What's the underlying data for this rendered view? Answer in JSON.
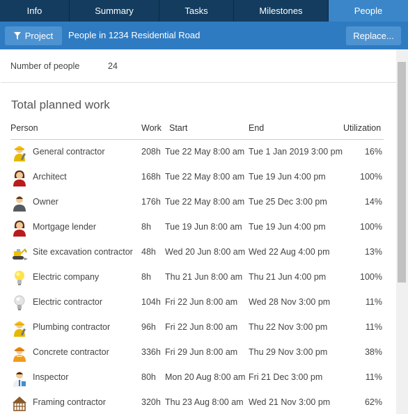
{
  "tabs": [
    {
      "label": "Info",
      "active": false
    },
    {
      "label": "Summary",
      "active": false
    },
    {
      "label": "Tasks",
      "active": false
    },
    {
      "label": "Milestones",
      "active": false
    },
    {
      "label": "People",
      "active": true
    }
  ],
  "toolbar": {
    "project_label": "Project",
    "title": "People in 1234 Residential Road",
    "replace_label": "Replace..."
  },
  "summary": {
    "count_label": "Number of people",
    "count_value": "24"
  },
  "section_title": "Total planned work",
  "table": {
    "headers": {
      "person": "Person",
      "work": "Work",
      "start": "Start",
      "end": "End",
      "utilization": "Utilization"
    },
    "rows": [
      {
        "name": "General contractor",
        "work": "208h",
        "start": "Tue 22 May 8:00 am",
        "end": "Tue 1 Jan 2019 3:00 pm",
        "util": "16%",
        "icon": "construction-worker-icon"
      },
      {
        "name": "Architect",
        "work": "168h",
        "start": "Tue 22 May 8:00 am",
        "end": "Tue 19 Jun 4:00 pm",
        "util": "100%",
        "icon": "person-female-icon"
      },
      {
        "name": "Owner",
        "work": "176h",
        "start": "Tue 22 May 8:00 am",
        "end": "Tue 25 Dec 3:00 pm",
        "util": "14%",
        "icon": "person-icon"
      },
      {
        "name": "Mortgage lender",
        "work": "8h",
        "start": "Tue 19 Jun 8:00 am",
        "end": "Tue 19 Jun 4:00 pm",
        "util": "100%",
        "icon": "person-female-icon"
      },
      {
        "name": "Site excavation contractor",
        "work": "48h",
        "start": "Wed 20 Jun 8:00 am",
        "end": "Wed 22 Aug 4:00 pm",
        "util": "13%",
        "icon": "excavator-icon"
      },
      {
        "name": "Electric company",
        "work": "8h",
        "start": "Thu 21 Jun 8:00 am",
        "end": "Thu 21 Jun 4:00 pm",
        "util": "100%",
        "icon": "lightbulb-on-icon"
      },
      {
        "name": "Electric contractor",
        "work": "104h",
        "start": "Fri 22 Jun 8:00 am",
        "end": "Wed 28 Nov 3:00 pm",
        "util": "11%",
        "icon": "lightbulb-off-icon"
      },
      {
        "name": "Plumbing contractor",
        "work": "96h",
        "start": "Fri 22 Jun 8:00 am",
        "end": "Thu 22 Nov 3:00 pm",
        "util": "11%",
        "icon": "construction-worker-icon"
      },
      {
        "name": "Concrete contractor",
        "work": "336h",
        "start": "Fri 29 Jun 8:00 am",
        "end": "Thu 29 Nov 3:00 pm",
        "util": "38%",
        "icon": "hardhat-worker-icon"
      },
      {
        "name": "Inspector",
        "work": "80h",
        "start": "Mon 20 Aug 8:00 am",
        "end": "Fri 21 Dec 3:00 pm",
        "util": "11%",
        "icon": "inspector-icon"
      },
      {
        "name": "Framing contractor",
        "work": "320h",
        "start": "Thu 23 Aug 8:00 am",
        "end": "Wed 21 Nov 3:00 pm",
        "util": "62%",
        "icon": "house-frame-icon"
      }
    ]
  },
  "colors": {
    "tab_bar": "#133c5e",
    "tab_active": "#3b86c9",
    "toolbar": "#2f7bc1",
    "toolbar_button": "#4e93d1"
  }
}
